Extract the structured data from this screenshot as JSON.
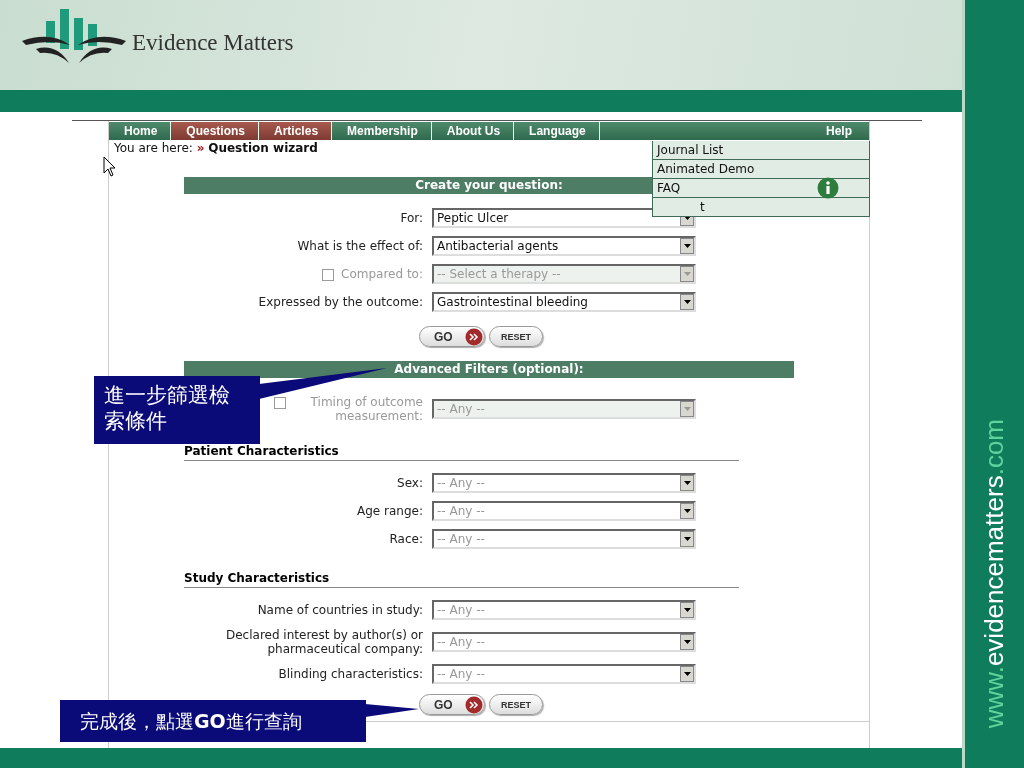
{
  "header": {
    "logo_text": "Evidence Matters"
  },
  "site_url": [
    {
      "text": "www.",
      "highlight": true
    },
    {
      "text": "evidencematters",
      "highlight": false
    },
    {
      "text": ".com",
      "highlight": true
    }
  ],
  "nav": {
    "items": [
      {
        "label": "Home",
        "selected": false
      },
      {
        "label": "Questions",
        "selected": true
      },
      {
        "label": "Articles",
        "selected": true
      },
      {
        "label": "Membership",
        "selected": false
      },
      {
        "label": "About Us",
        "selected": false
      },
      {
        "label": "Language",
        "selected": false
      }
    ],
    "help": "Help"
  },
  "help_menu": [
    "Journal List",
    "Animated Demo",
    "FAQ",
    "t"
  ],
  "breadcrumb": {
    "prefix": "You are here:",
    "separator": "»",
    "current": "Question wizard"
  },
  "question": {
    "title": "Create your question:",
    "fields": [
      {
        "kind": "select",
        "label": "For:",
        "value": "Peptic Ulcer",
        "disabled": false
      },
      {
        "kind": "select",
        "label": "What is the effect of:",
        "value": "Antibacterial agents",
        "disabled": false
      },
      {
        "kind": "checkbox-select",
        "label": "Compared to:",
        "placeholder": "-- Select a therapy --",
        "checked": false,
        "disabled": true
      },
      {
        "kind": "select",
        "label": "Expressed by the outcome:",
        "value": "Gastrointestinal bleeding",
        "disabled": false
      }
    ],
    "buttons": [
      {
        "kind": "go",
        "label": "GO"
      },
      {
        "kind": "reset",
        "label": "RESET"
      }
    ]
  },
  "advanced": {
    "title": "Advanced Filters (optional):",
    "fields": [
      {
        "kind": "checkbox-select",
        "label": "Timing of outcome measurement:",
        "placeholder": "-- Any --",
        "checked": false,
        "disabled": true
      }
    ],
    "groups": [
      {
        "heading": "Patient Characteristics",
        "fields": [
          {
            "kind": "select",
            "label": "Sex:",
            "placeholder": "-- Any --",
            "disabled": false
          },
          {
            "kind": "select",
            "label": "Age range:",
            "placeholder": "-- Any --",
            "disabled": false
          },
          {
            "kind": "select",
            "label": "Race:",
            "placeholder": "-- Any --",
            "disabled": false
          }
        ]
      },
      {
        "heading": "Study Characteristics",
        "fields": [
          {
            "kind": "select",
            "label": "Name of countries in study:",
            "placeholder": "-- Any --",
            "disabled": false
          },
          {
            "kind": "select",
            "label": "Declared interest by author(s) or pharmaceutical company:",
            "placeholder": "-- Any --",
            "disabled": false
          },
          {
            "kind": "select",
            "label": "Blinding characteristics:",
            "placeholder": "-- Any --",
            "disabled": false
          }
        ]
      }
    ],
    "buttons": [
      {
        "kind": "go",
        "label": "GO"
      },
      {
        "kind": "reset",
        "label": "RESET"
      }
    ]
  },
  "callouts": [
    "進一步篩選檢索條件",
    "完成後，點選**GO**進行查詢"
  ]
}
